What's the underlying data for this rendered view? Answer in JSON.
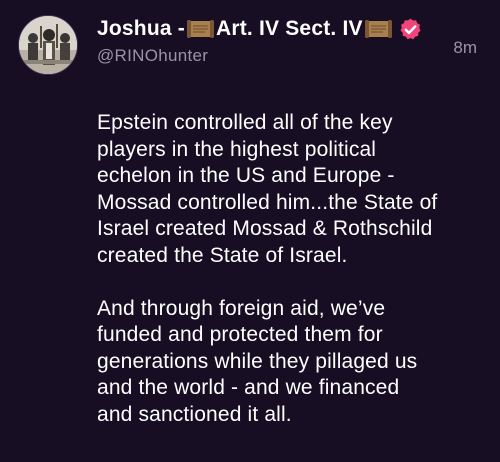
{
  "post": {
    "author": {
      "name_prefix": "Joshua -",
      "name_title": "Art. IV Sect. IV",
      "handle": "@RINOhunter",
      "verified": true
    },
    "timestamp": "8m",
    "paragraphs": [
      "Epstein controlled all of the key\nplayers in the highest political\nechelon in the US and Europe -\nMossad controlled him...the State of\nIsrael created Mossad & Rothschild\ncreated the State of Israel.",
      "And through foreign aid, we’ve\nfunded and protected them for\ngenerations while they pillaged us\nand the world - and we financed\nand sanctioned it all."
    ]
  },
  "icons": {
    "name_emoji": "scroll-icon",
    "badge": "verified-badge-icon"
  },
  "colors": {
    "background": "#170e24",
    "text": "#ffffff",
    "muted": "#9a93a8",
    "verified": "#f0447a"
  }
}
